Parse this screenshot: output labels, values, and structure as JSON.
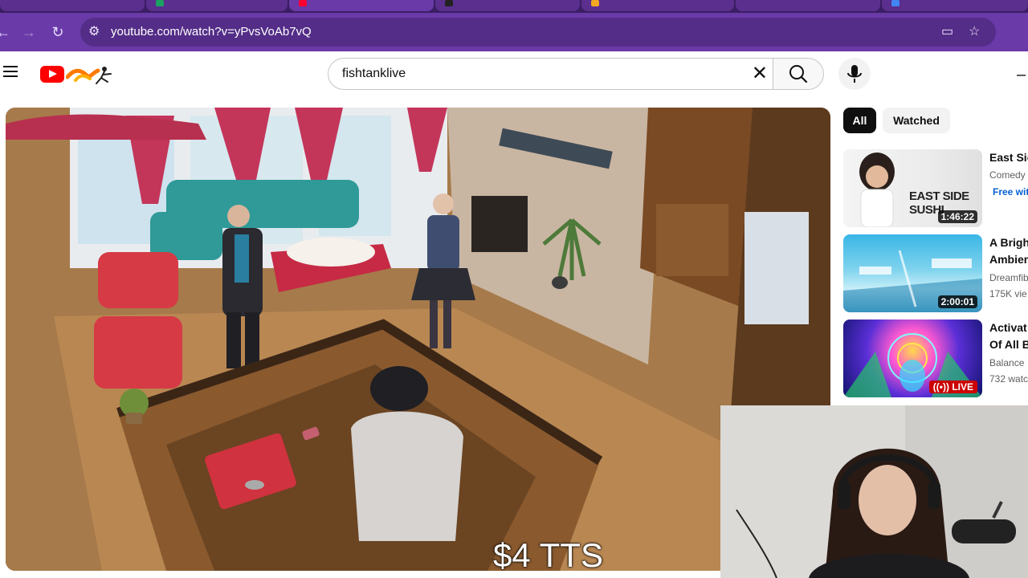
{
  "browser": {
    "url": "youtube.com/watch?v=yPvsVoAb7vQ",
    "back_icon": "back-arrow-icon",
    "forward_icon": "forward-arrow-icon",
    "reload_icon": "reload-icon",
    "accent": "#6a3aa8"
  },
  "youtube": {
    "search_query": "fishtanklive",
    "chips": [
      "All",
      "Watched"
    ],
    "brand_color": "#ff0000"
  },
  "recommendations": [
    {
      "title": "East Sic",
      "meta": "Comedy",
      "badge": "Free wit",
      "duration": "1:46:22",
      "thumb_text": "EAST SIDE SUSHI"
    },
    {
      "title": "A Brigh",
      "title2": "Ambien",
      "meta": "Dreamfib",
      "meta2": "175K vie",
      "duration": "2:00:01"
    },
    {
      "title": "Activat",
      "title2": "Of All B",
      "meta": "Balance",
      "meta2": "732 watc",
      "live": "LIVE"
    }
  ],
  "overlay": {
    "tts_text": "$4 TTS"
  }
}
